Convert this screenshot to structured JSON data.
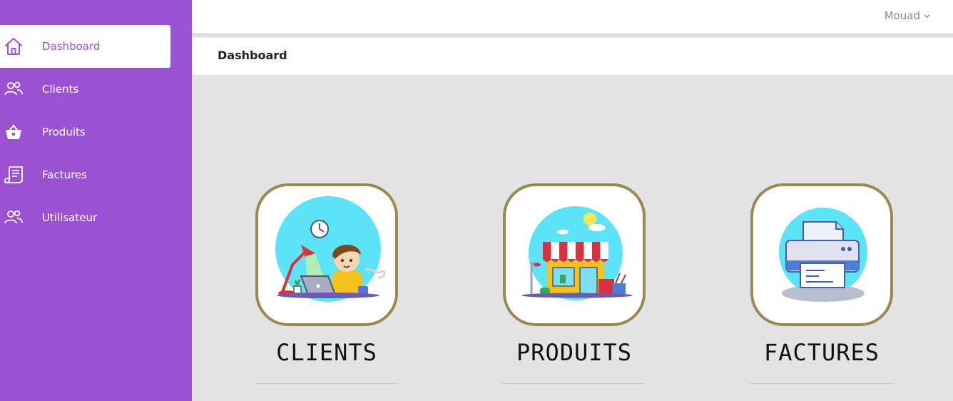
{
  "sidebar": {
    "items": [
      {
        "label": "Dashboard",
        "icon": "home-icon",
        "active": true
      },
      {
        "label": "Clients",
        "icon": "users-icon"
      },
      {
        "label": "Produits",
        "icon": "basket-icon"
      },
      {
        "label": "Factures",
        "icon": "invoice-icon"
      },
      {
        "label": "Utilisateur",
        "icon": "users-icon"
      }
    ]
  },
  "header": {
    "user_name": "Mouad",
    "user_menu_icon": "chevron-down-icon"
  },
  "page": {
    "title": "Dashboard"
  },
  "cards": [
    {
      "title": "CLIENTS",
      "illustration": "person-laptop-illustration"
    },
    {
      "title": "PRODUITS",
      "illustration": "shop-illustration"
    },
    {
      "title": "FACTURES",
      "illustration": "printer-illustration"
    }
  ],
  "colors": {
    "sidebar_bg": "#9b51d2",
    "active_text": "#9b51d2",
    "content_bg": "#e3e3e3",
    "card_border": "#998a50",
    "illustration_sky": "#5ce3f7"
  }
}
